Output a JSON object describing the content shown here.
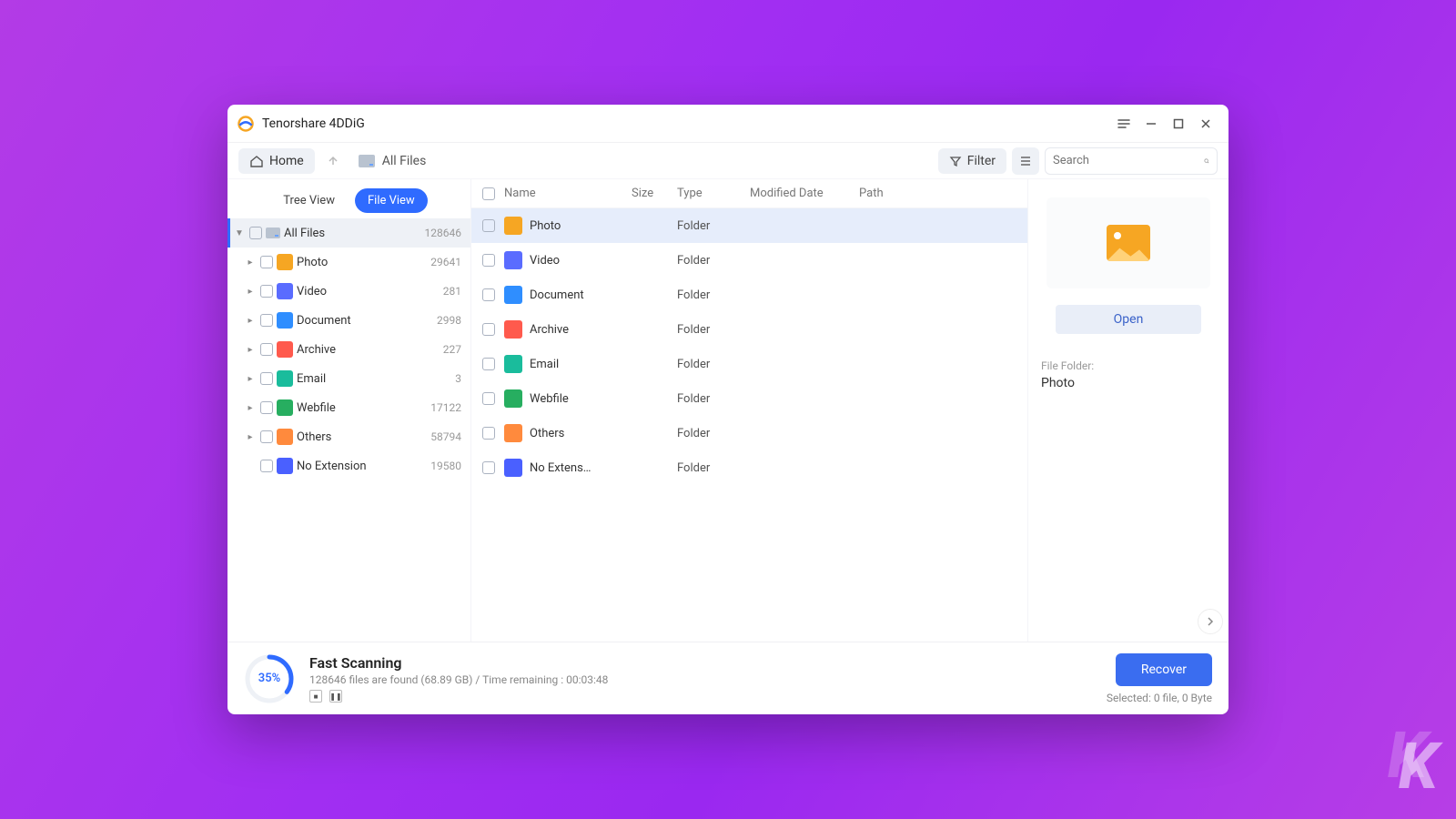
{
  "app": {
    "title": "Tenorshare 4DDiG"
  },
  "toolbar": {
    "home_label": "Home",
    "breadcrumb": "All Files",
    "filter_label": "Filter",
    "search_placeholder": "Search"
  },
  "sidebar": {
    "tabs": {
      "tree": "Tree View",
      "file": "File View"
    },
    "root": {
      "label": "All Files",
      "count": "128646"
    },
    "items": [
      {
        "label": "Photo",
        "count": "29641",
        "color": "#f6a623"
      },
      {
        "label": "Video",
        "count": "281",
        "color": "#5a6cff"
      },
      {
        "label": "Document",
        "count": "2998",
        "color": "#2f8eff"
      },
      {
        "label": "Archive",
        "count": "227",
        "color": "#ff5a4d"
      },
      {
        "label": "Email",
        "count": "3",
        "color": "#1abc9c"
      },
      {
        "label": "Webfile",
        "count": "17122",
        "color": "#27ae60"
      },
      {
        "label": "Others",
        "count": "58794",
        "color": "#ff8a3d"
      },
      {
        "label": "No Extension",
        "count": "19580",
        "color": "#4a60ff",
        "no_caret": true
      }
    ]
  },
  "table": {
    "headers": {
      "name": "Name",
      "size": "Size",
      "type": "Type",
      "modified": "Modified Date",
      "path": "Path"
    },
    "rows": [
      {
        "name": "Photo",
        "type": "Folder",
        "color": "#f6a623",
        "selected": true
      },
      {
        "name": "Video",
        "type": "Folder",
        "color": "#5a6cff"
      },
      {
        "name": "Document",
        "type": "Folder",
        "color": "#2f8eff"
      },
      {
        "name": "Archive",
        "type": "Folder",
        "color": "#ff5a4d"
      },
      {
        "name": "Email",
        "type": "Folder",
        "color": "#1abc9c"
      },
      {
        "name": "Webfile",
        "type": "Folder",
        "color": "#27ae60"
      },
      {
        "name": "Others",
        "type": "Folder",
        "color": "#ff8a3d"
      },
      {
        "name": "No Extens…",
        "type": "Folder",
        "color": "#4a60ff"
      }
    ]
  },
  "preview": {
    "open_label": "Open",
    "meta_label": "File Folder:",
    "meta_value": "Photo"
  },
  "footer": {
    "percent": "35%",
    "title": "Fast Scanning",
    "subtext": "128646 files are found (68.89 GB) /   Time remaining : 00:03:48",
    "recover_label": "Recover",
    "selected_text": "Selected: 0 file, 0 Byte"
  }
}
